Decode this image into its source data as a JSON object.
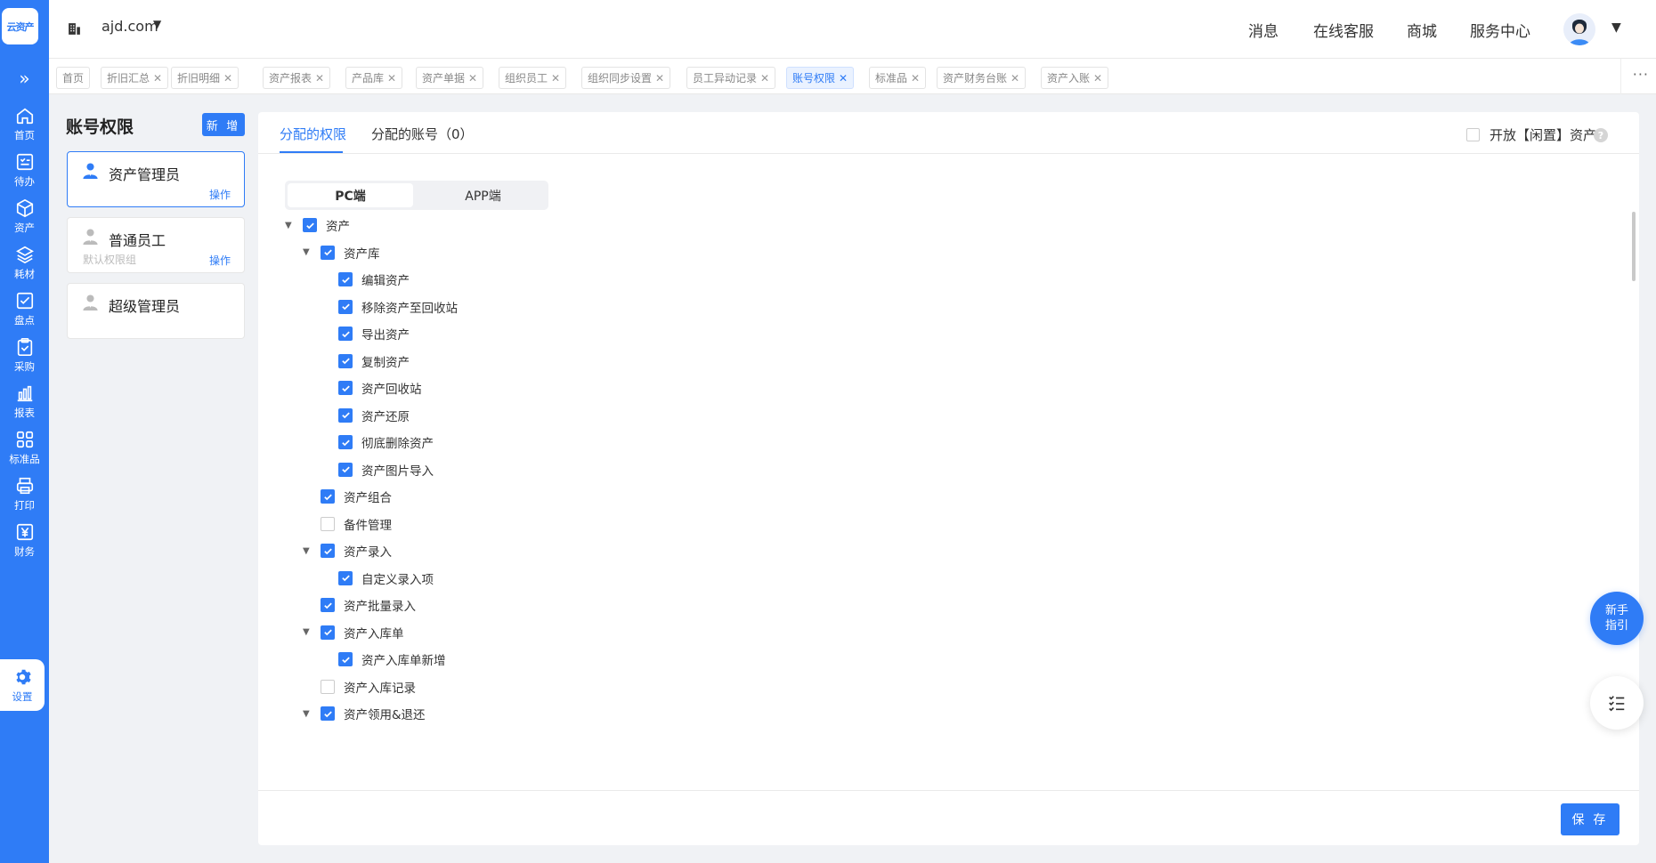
{
  "brand": {
    "logo_text": "云资产",
    "accent": "#2f7cf6"
  },
  "nav": {
    "items": [
      {
        "label": "首页",
        "icon": "home-icon"
      },
      {
        "label": "待办",
        "icon": "todo-icon"
      },
      {
        "label": "资产",
        "icon": "asset-icon"
      },
      {
        "label": "耗材",
        "icon": "layers-icon"
      },
      {
        "label": "盘点",
        "icon": "inventory-check-icon"
      },
      {
        "label": "采购",
        "icon": "purchase-icon"
      },
      {
        "label": "报表",
        "icon": "report-chart-icon"
      },
      {
        "label": "标准品",
        "icon": "grid-icon"
      },
      {
        "label": "打印",
        "icon": "printer-icon"
      },
      {
        "label": "财务",
        "icon": "finance-icon"
      },
      {
        "label": "设置",
        "icon": "gear-icon",
        "active": true
      }
    ]
  },
  "header": {
    "org_name": "ajd.com",
    "links": [
      "消息",
      "在线客服",
      "商城",
      "服务中心"
    ]
  },
  "tabs": [
    {
      "label": "首页",
      "closable": false
    },
    {
      "label": "折旧汇总",
      "closable": true
    },
    {
      "label": "折旧明细",
      "closable": true
    },
    {
      "label": "资产报表",
      "closable": true
    },
    {
      "label": "产品库",
      "closable": true
    },
    {
      "label": "资产单据",
      "closable": true
    },
    {
      "label": "组织员工",
      "closable": true
    },
    {
      "label": "组织同步设置",
      "closable": true
    },
    {
      "label": "员工异动记录",
      "closable": true
    },
    {
      "label": "账号权限",
      "closable": true,
      "active": true
    },
    {
      "label": "标准品",
      "closable": true
    },
    {
      "label": "资产财务台账",
      "closable": true
    },
    {
      "label": "资产入账",
      "closable": true
    }
  ],
  "roles_panel": {
    "title": "账号权限",
    "add_label": "新 增",
    "roles": [
      {
        "name": "资产管理员",
        "sub": "",
        "op": "操作",
        "selected": true
      },
      {
        "name": "普通员工",
        "sub": "默认权限组",
        "op": "操作",
        "selected": false
      },
      {
        "name": "超级管理员",
        "sub": "",
        "op": "",
        "selected": false
      }
    ]
  },
  "main": {
    "tabs": [
      "分配的权限",
      "分配的账号（0）"
    ],
    "idle_option": "开放【闲置】资产",
    "idle_checked": false,
    "segments": [
      "PC端",
      "APP端"
    ],
    "active_segment": "PC端",
    "save_label": "保 存"
  },
  "tree": [
    {
      "label": "资产",
      "level": 0,
      "checked": true,
      "expandable": true
    },
    {
      "label": "资产库",
      "level": 1,
      "checked": true,
      "expandable": true
    },
    {
      "label": "编辑资产",
      "level": 2,
      "checked": true,
      "expandable": false
    },
    {
      "label": "移除资产至回收站",
      "level": 2,
      "checked": true,
      "expandable": false
    },
    {
      "label": "导出资产",
      "level": 2,
      "checked": true,
      "expandable": false
    },
    {
      "label": "复制资产",
      "level": 2,
      "checked": true,
      "expandable": false
    },
    {
      "label": "资产回收站",
      "level": 2,
      "checked": true,
      "expandable": false
    },
    {
      "label": "资产还原",
      "level": 2,
      "checked": true,
      "expandable": false
    },
    {
      "label": "彻底删除资产",
      "level": 2,
      "checked": true,
      "expandable": false
    },
    {
      "label": "资产图片导入",
      "level": 2,
      "checked": true,
      "expandable": false
    },
    {
      "label": "资产组合",
      "level": 1,
      "checked": true,
      "expandable": false
    },
    {
      "label": "备件管理",
      "level": 1,
      "checked": false,
      "expandable": false
    },
    {
      "label": "资产录入",
      "level": 1,
      "checked": true,
      "expandable": true
    },
    {
      "label": "自定义录入项",
      "level": 2,
      "checked": true,
      "expandable": false
    },
    {
      "label": "资产批量录入",
      "level": 1,
      "checked": true,
      "expandable": false
    },
    {
      "label": "资产入库单",
      "level": 1,
      "checked": true,
      "expandable": true
    },
    {
      "label": "资产入库单新增",
      "level": 2,
      "checked": true,
      "expandable": false
    },
    {
      "label": "资产入库记录",
      "level": 1,
      "checked": false,
      "expandable": false
    },
    {
      "label": "资产领用&退还",
      "level": 1,
      "checked": true,
      "expandable": true
    }
  ],
  "floating": {
    "guide_label": "新手指引"
  }
}
